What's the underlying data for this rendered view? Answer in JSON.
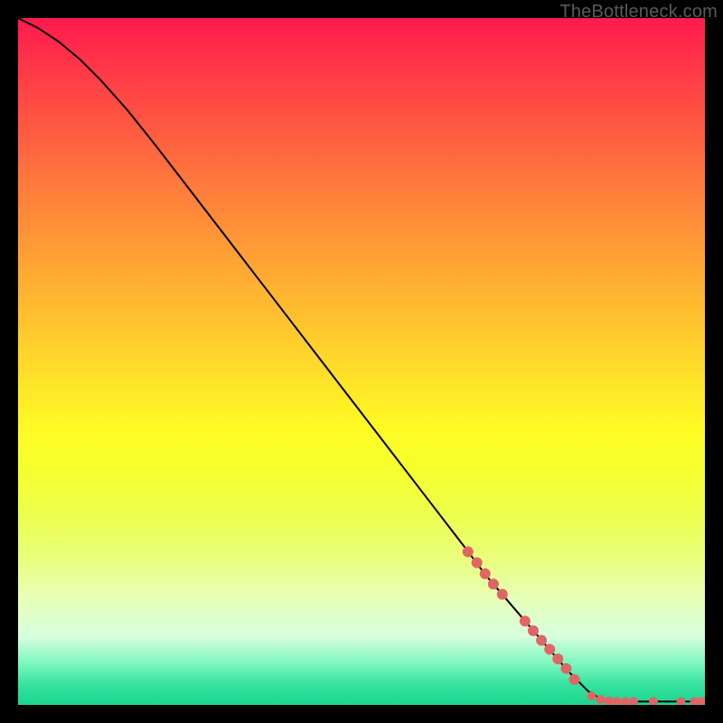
{
  "watermark": "TheBottleneck.com",
  "chart_data": {
    "type": "line",
    "title": "",
    "xlabel": "",
    "ylabel": "",
    "xlim": [
      0,
      100
    ],
    "ylim": [
      0,
      100
    ],
    "grid": false,
    "legend": false,
    "curve": [
      {
        "x": 0,
        "y": 100
      },
      {
        "x": 3,
        "y": 98.5
      },
      {
        "x": 6,
        "y": 96.5
      },
      {
        "x": 9,
        "y": 94
      },
      {
        "x": 12,
        "y": 91
      },
      {
        "x": 16,
        "y": 86.5
      },
      {
        "x": 20,
        "y": 81.5
      },
      {
        "x": 25,
        "y": 75
      },
      {
        "x": 30,
        "y": 68.5
      },
      {
        "x": 35,
        "y": 62
      },
      {
        "x": 40,
        "y": 55.5
      },
      {
        "x": 45,
        "y": 49
      },
      {
        "x": 50,
        "y": 42.5
      },
      {
        "x": 55,
        "y": 36
      },
      {
        "x": 60,
        "y": 29.5
      },
      {
        "x": 65,
        "y": 23
      },
      {
        "x": 68,
        "y": 19
      },
      {
        "x": 71,
        "y": 15.5
      },
      {
        "x": 74,
        "y": 12
      },
      {
        "x": 77,
        "y": 8.5
      },
      {
        "x": 80,
        "y": 5
      },
      {
        "x": 83,
        "y": 2
      },
      {
        "x": 85,
        "y": 0.8
      },
      {
        "x": 88,
        "y": 0.5
      },
      {
        "x": 91,
        "y": 0.5
      },
      {
        "x": 94,
        "y": 0.5
      },
      {
        "x": 97,
        "y": 0.5
      },
      {
        "x": 100,
        "y": 0.5
      }
    ],
    "marker_clusters": [
      {
        "x": 65.5,
        "y": 22.3,
        "r": 6
      },
      {
        "x": 66.8,
        "y": 20.7,
        "r": 6
      },
      {
        "x": 68.0,
        "y": 19.1,
        "r": 6
      },
      {
        "x": 69.2,
        "y": 17.6,
        "r": 6
      },
      {
        "x": 70.5,
        "y": 16.1,
        "r": 6
      },
      {
        "x": 73.8,
        "y": 12.2,
        "r": 6
      },
      {
        "x": 75.0,
        "y": 10.8,
        "r": 6
      },
      {
        "x": 76.2,
        "y": 9.4,
        "r": 6
      },
      {
        "x": 77.4,
        "y": 8.1,
        "r": 6
      },
      {
        "x": 78.6,
        "y": 6.7,
        "r": 6
      },
      {
        "x": 79.8,
        "y": 5.3,
        "r": 6
      },
      {
        "x": 81.0,
        "y": 3.7,
        "r": 6
      },
      {
        "x": 83.5,
        "y": 1.3,
        "r": 5
      },
      {
        "x": 84.8,
        "y": 0.8,
        "r": 5
      },
      {
        "x": 86.0,
        "y": 0.6,
        "r": 5
      },
      {
        "x": 87.2,
        "y": 0.5,
        "r": 5
      },
      {
        "x": 88.4,
        "y": 0.5,
        "r": 5
      },
      {
        "x": 89.6,
        "y": 0.5,
        "r": 5
      },
      {
        "x": 92.5,
        "y": 0.5,
        "r": 5
      },
      {
        "x": 96.5,
        "y": 0.5,
        "r": 5
      },
      {
        "x": 98.5,
        "y": 0.5,
        "r": 5
      },
      {
        "x": 99.5,
        "y": 0.5,
        "r": 5
      }
    ],
    "marker_color": "#e06666",
    "curve_color": "#000000"
  }
}
